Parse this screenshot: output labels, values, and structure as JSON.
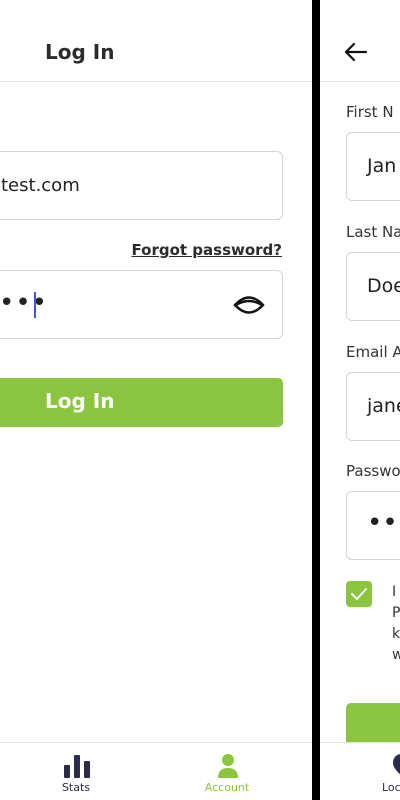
{
  "login_screen": {
    "title": "Log In",
    "email_value": "test.com",
    "forgot_password": "Forgot password?",
    "password_dots": "•••",
    "login_button": "Log In",
    "tabs": [
      {
        "label": "Stats",
        "icon": "bar-chart-icon"
      },
      {
        "label": "Account",
        "icon": "user-icon",
        "active": true
      }
    ]
  },
  "signup_screen": {
    "fields": [
      {
        "label": "First N",
        "value": "Jan"
      },
      {
        "label": "Last Na",
        "value": "Doe"
      },
      {
        "label": "Email A",
        "value": "jane"
      },
      {
        "label": "Passwo",
        "value": "•••"
      }
    ],
    "terms_text": "I\nP\nk\nw",
    "terms_checked": true,
    "tab_partial_label": "Loc"
  },
  "colors": {
    "accent": "#8bc43f",
    "caret": "#3c5bdc",
    "text_dark": "#2b2b2b",
    "tab_inactive": "#2b2b4b"
  }
}
